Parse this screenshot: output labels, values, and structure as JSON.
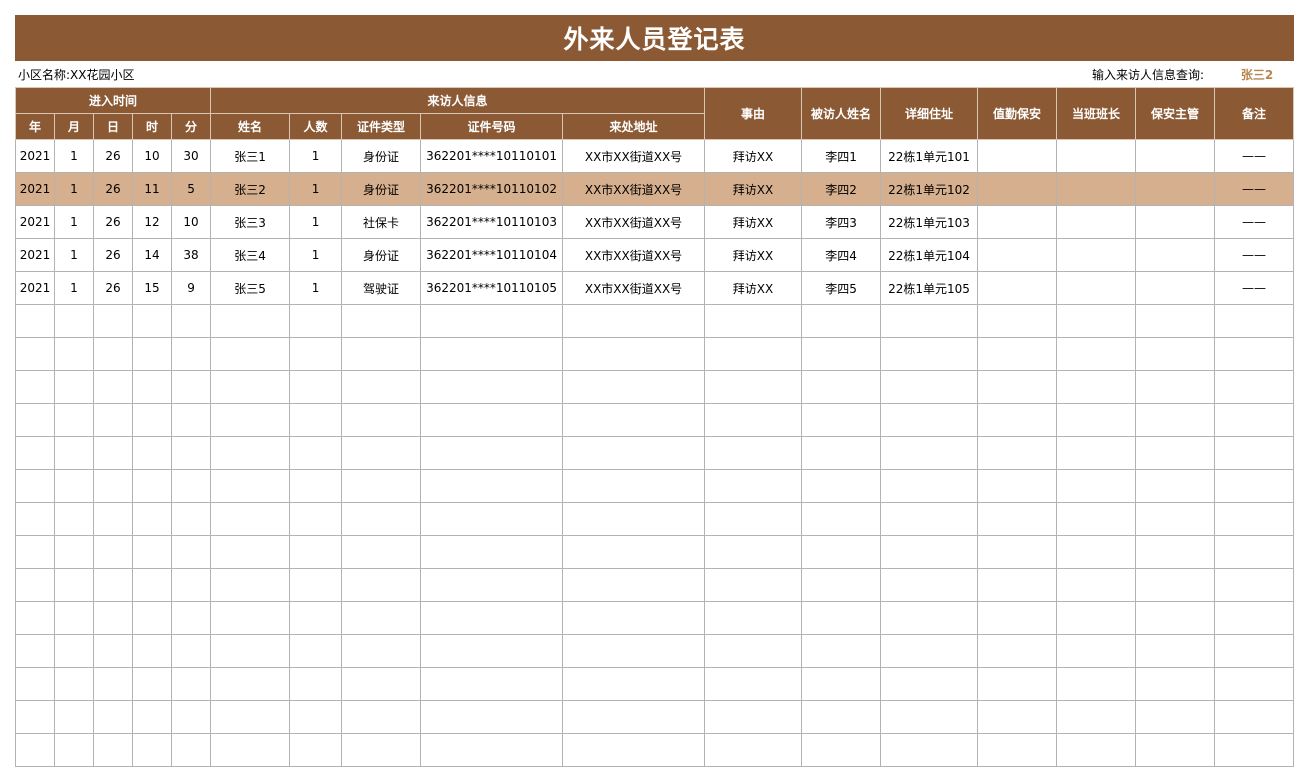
{
  "title": "外来人员登记表",
  "community_label": "小区名称:",
  "community_name": "XX花园小区",
  "query_label": "输入来访人信息查询:",
  "query_value": "张三2",
  "colors": {
    "header_bg": "#8b5a35",
    "highlight_row": "#d6b08e",
    "query_value": "#b8864f"
  },
  "headers": {
    "entry_time": "进入时间",
    "visitor_info": "来访人信息",
    "reason": "事由",
    "visited_name": "被访人姓名",
    "address_detail": "详细住址",
    "guard": "值勤保安",
    "shift_leader": "当班班长",
    "security_manager": "保安主管",
    "remark": "备注",
    "year": "年",
    "month": "月",
    "day": "日",
    "hour": "时",
    "minute": "分",
    "name": "姓名",
    "count": "人数",
    "id_type": "证件类型",
    "id_number": "证件号码",
    "origin": "来处地址"
  },
  "rows": [
    [
      "2021",
      "1",
      "26",
      "10",
      "30",
      "张三1",
      "1",
      "身份证",
      "362201****10110101",
      "XX市XX街道XX号",
      "拜访XX",
      "李四1",
      "22栋1单元101",
      "",
      "",
      "",
      "——"
    ],
    [
      "2021",
      "1",
      "26",
      "11",
      "5",
      "张三2",
      "1",
      "身份证",
      "362201****10110102",
      "XX市XX街道XX号",
      "拜访XX",
      "李四2",
      "22栋1单元102",
      "",
      "",
      "",
      "——"
    ],
    [
      "2021",
      "1",
      "26",
      "12",
      "10",
      "张三3",
      "1",
      "社保卡",
      "362201****10110103",
      "XX市XX街道XX号",
      "拜访XX",
      "李四3",
      "22栋1单元103",
      "",
      "",
      "",
      "——"
    ],
    [
      "2021",
      "1",
      "26",
      "14",
      "38",
      "张三4",
      "1",
      "身份证",
      "362201****10110104",
      "XX市XX街道XX号",
      "拜访XX",
      "李四4",
      "22栋1单元104",
      "",
      "",
      "",
      "——"
    ],
    [
      "2021",
      "1",
      "26",
      "15",
      "9",
      "张三5",
      "1",
      "驾驶证",
      "362201****10110105",
      "XX市XX街道XX号",
      "拜访XX",
      "李四5",
      "22栋1单元105",
      "",
      "",
      "",
      "——"
    ]
  ],
  "highlight_row_index": 1,
  "empty_row_count": 14
}
